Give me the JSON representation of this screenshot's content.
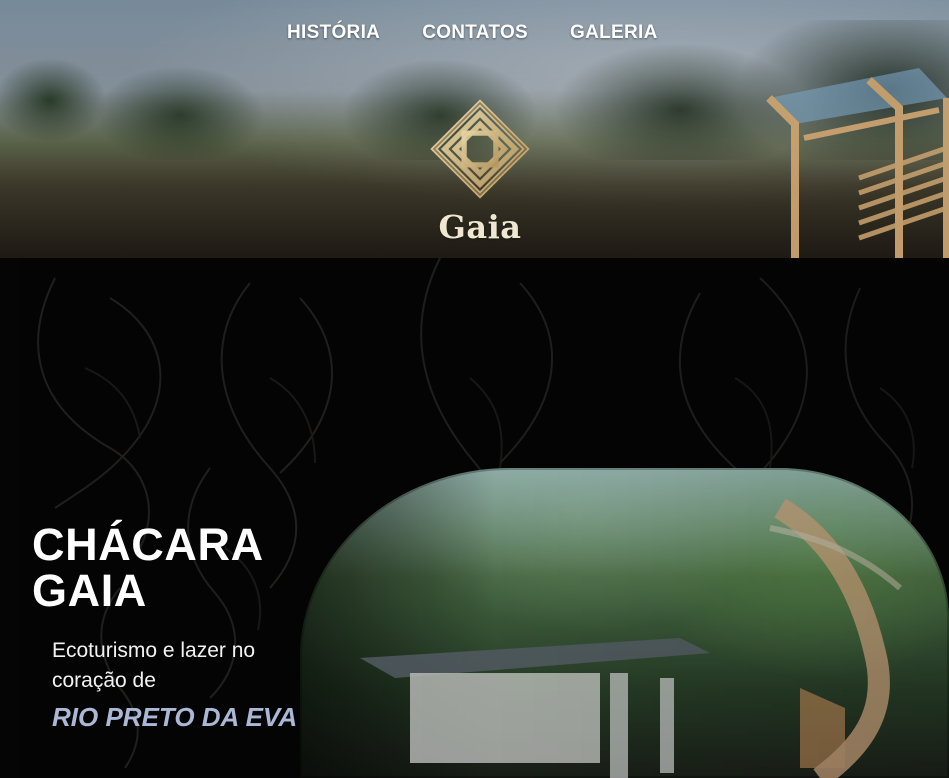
{
  "nav": {
    "items": [
      {
        "label": "HISTÓRIA"
      },
      {
        "label": "CONTATOS"
      },
      {
        "label": "GALERIA"
      }
    ]
  },
  "hero": {
    "logo_text": "Gaia",
    "logo_icon": "gaia-knot-icon"
  },
  "intro": {
    "title_line_1": "CHÁCARA",
    "title_line_2": "GAIA",
    "subtitle": "Ecoturismo e lazer no coração de",
    "location": "RIO PRETO DA EVA"
  },
  "colors": {
    "background": "#050505",
    "text_primary": "#ffffff",
    "accent_location": "#aab8d6",
    "logo_gold": "#cdb88b",
    "logo_text": "#efe7cf"
  }
}
